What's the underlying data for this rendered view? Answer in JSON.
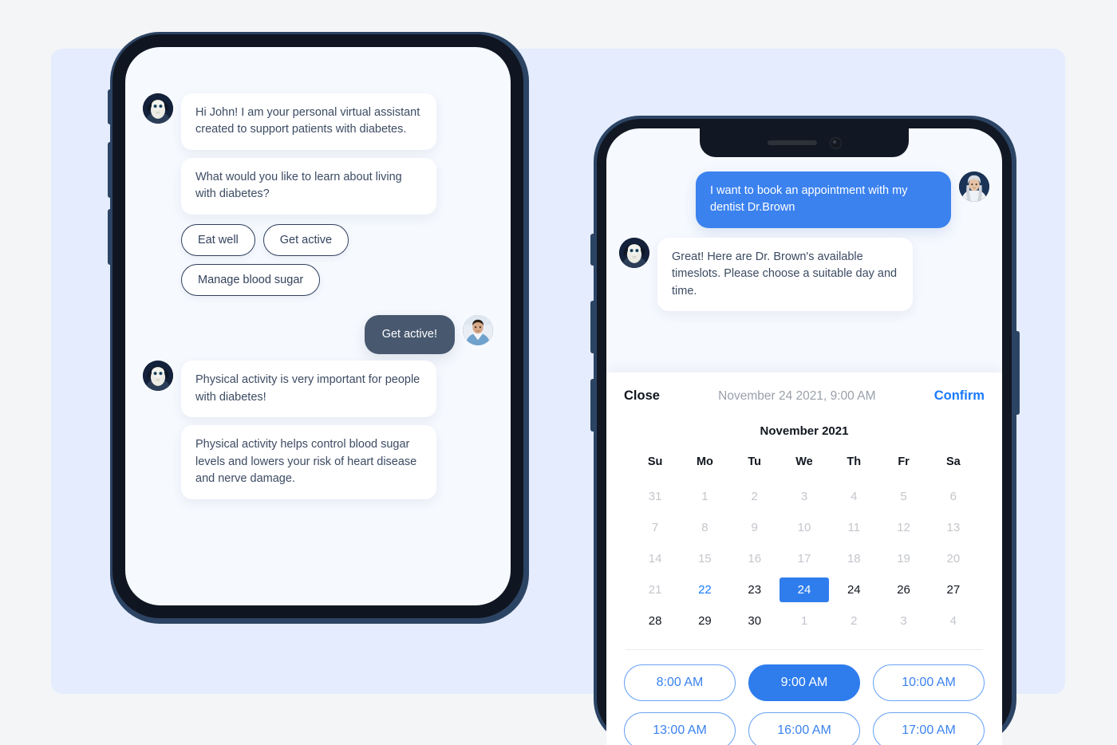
{
  "colors": {
    "page_bg": "#f4f5f7",
    "panel_bg": "#e4ecfd",
    "screen_bg": "#f6f9fe",
    "accent_blue": "#3b82ef",
    "selected_blue": "#2f7ded",
    "link_blue": "#1a7afb",
    "bot_bubble": "#ffffff",
    "user_bubble_dark": "#47586f",
    "text_dark": "#11161f",
    "text_body": "#3c4b63",
    "text_muted": "#c3c6cc",
    "frame_outer": "#2c4464",
    "frame_inner": "#111823"
  },
  "left_phone": {
    "name": "diabetes-assistant-chat",
    "messages": [
      {
        "id": "bot-intro-1",
        "sender": "bot",
        "avatar": "robot-avatar",
        "text": "Hi John! I am your personal virtual assistant created to support patients with diabetes."
      },
      {
        "id": "bot-intro-2",
        "sender": "bot",
        "avatar": null,
        "text": "What would you like to learn about living with diabetes?"
      },
      {
        "id": "user-reply-1",
        "sender": "user",
        "avatar": "man-avatar",
        "text": "Get active!"
      },
      {
        "id": "bot-answer-1",
        "sender": "bot",
        "avatar": "robot-avatar",
        "text": "Physical activity is very important for people with diabetes!"
      },
      {
        "id": "bot-answer-2",
        "sender": "bot",
        "avatar": null,
        "text": "Physical activity helps control blood sugar levels and lowers your risk of heart disease and nerve damage."
      }
    ],
    "quick_replies": [
      {
        "id": "eat-well",
        "label": "Eat well"
      },
      {
        "id": "get-active",
        "label": "Get active"
      },
      {
        "id": "manage-blood-sugar",
        "label": "Manage blood sugar"
      }
    ]
  },
  "right_phone": {
    "name": "appointment-booking-chat",
    "messages": [
      {
        "id": "user-request",
        "sender": "user",
        "avatar": "woman-avatar",
        "text": "I want to book an appointment with my dentist Dr.Brown"
      },
      {
        "id": "bot-timeslots",
        "sender": "bot",
        "avatar": "robot-avatar",
        "text": "Great! Here are Dr. Brown's available timeslots. Please choose a suitable day and time."
      }
    ],
    "date_picker": {
      "close_label": "Close",
      "selected_datetime": "November 24 2021, 9:00 AM",
      "confirm_label": "Confirm",
      "month_label": "November 2021",
      "weekday_headers": [
        "Su",
        "Mo",
        "Tu",
        "We",
        "Th",
        "Fr",
        "Sa"
      ],
      "weeks": [
        [
          {
            "d": "31",
            "state": "muted"
          },
          {
            "d": "1",
            "state": "muted"
          },
          {
            "d": "2",
            "state": "muted"
          },
          {
            "d": "3",
            "state": "muted"
          },
          {
            "d": "4",
            "state": "muted"
          },
          {
            "d": "5",
            "state": "muted"
          },
          {
            "d": "6",
            "state": "muted"
          }
        ],
        [
          {
            "d": "7",
            "state": "muted"
          },
          {
            "d": "8",
            "state": "muted"
          },
          {
            "d": "9",
            "state": "muted"
          },
          {
            "d": "10",
            "state": "muted"
          },
          {
            "d": "11",
            "state": "muted"
          },
          {
            "d": "12",
            "state": "muted"
          },
          {
            "d": "13",
            "state": "muted"
          }
        ],
        [
          {
            "d": "14",
            "state": "muted"
          },
          {
            "d": "15",
            "state": "muted"
          },
          {
            "d": "16",
            "state": "muted"
          },
          {
            "d": "17",
            "state": "muted"
          },
          {
            "d": "18",
            "state": "muted"
          },
          {
            "d": "19",
            "state": "muted"
          },
          {
            "d": "20",
            "state": "muted"
          }
        ],
        [
          {
            "d": "21",
            "state": "muted"
          },
          {
            "d": "22",
            "state": "today"
          },
          {
            "d": "23",
            "state": "normal"
          },
          {
            "d": "24",
            "state": "selected"
          },
          {
            "d": "24",
            "state": "normal"
          },
          {
            "d": "26",
            "state": "normal"
          },
          {
            "d": "27",
            "state": "normal"
          }
        ],
        [
          {
            "d": "28",
            "state": "normal"
          },
          {
            "d": "29",
            "state": "normal"
          },
          {
            "d": "30",
            "state": "normal"
          },
          {
            "d": "1",
            "state": "muted"
          },
          {
            "d": "2",
            "state": "muted"
          },
          {
            "d": "3",
            "state": "muted"
          },
          {
            "d": "4",
            "state": "muted"
          }
        ]
      ],
      "time_slots": [
        {
          "label": "8:00 AM",
          "state": "normal"
        },
        {
          "label": "9:00 AM",
          "state": "active"
        },
        {
          "label": "10:00 AM",
          "state": "normal"
        },
        {
          "label": "13:00 AM",
          "state": "normal"
        },
        {
          "label": "16:00 AM",
          "state": "normal"
        },
        {
          "label": "17:00 AM",
          "state": "normal"
        }
      ]
    }
  }
}
